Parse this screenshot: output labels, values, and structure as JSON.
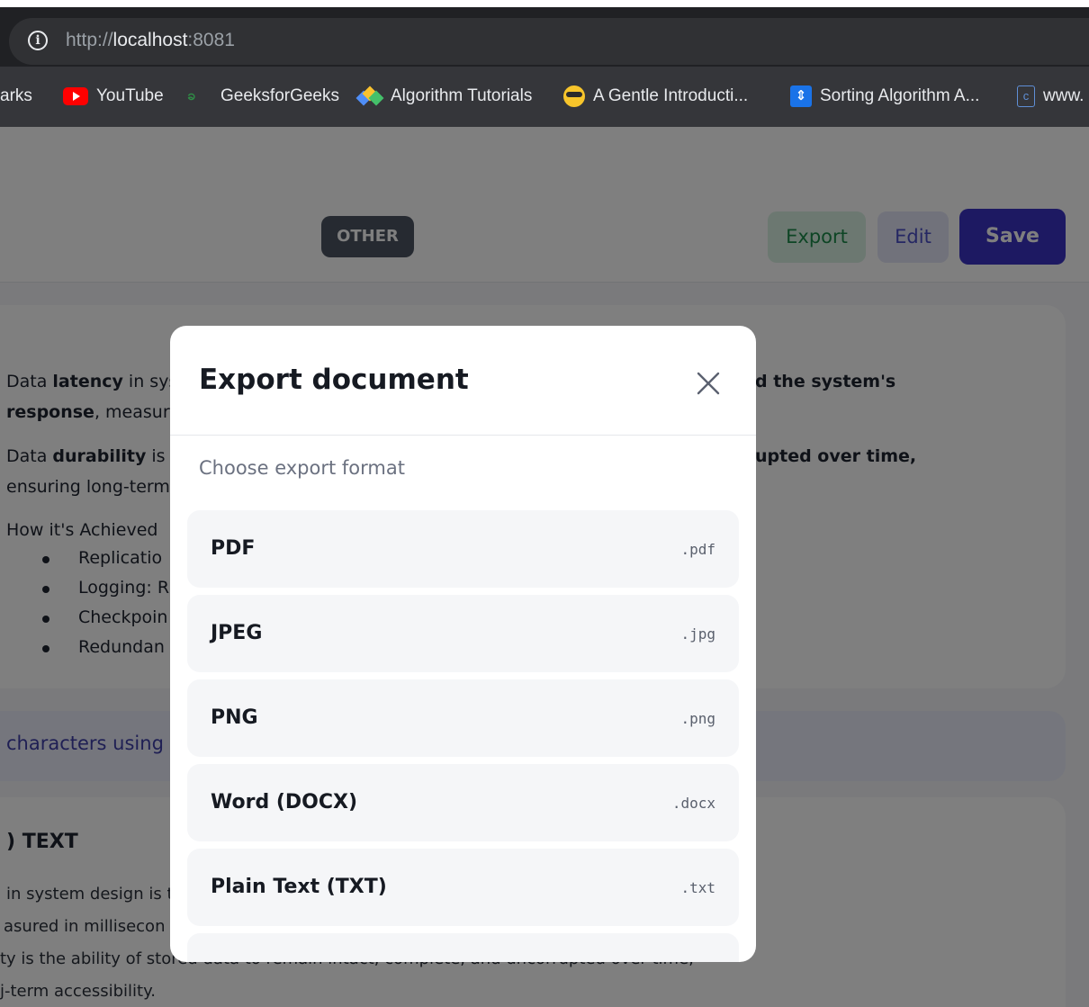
{
  "browser": {
    "url_scheme": "http://",
    "url_host": "localhost",
    "url_port": ":8081",
    "bookmarks": [
      {
        "label": "arks",
        "icon": "bookmarks-folder-icon"
      },
      {
        "label": "YouTube",
        "icon": "youtube-icon"
      },
      {
        "label": "GeeksforGeeks",
        "icon": "geeksforgeeks-icon"
      },
      {
        "label": "Algorithm Tutorials",
        "icon": "algorithm-tutorials-icon"
      },
      {
        "label": "A Gentle Introducti...",
        "icon": "sunglasses-emoji-icon"
      },
      {
        "label": "Sorting Algorithm A...",
        "icon": "sorting-algorithm-icon"
      },
      {
        "label": "www.",
        "icon": "c-file-icon"
      }
    ],
    "icons": {
      "gfg_glyph": "ခ",
      "sort_glyph": "⇕",
      "c_glyph": "c"
    }
  },
  "header": {
    "tag": "OTHER",
    "export_label": "Export",
    "edit_label": "Edit",
    "save_label": "Save"
  },
  "background": {
    "para1_prefix": "Data ",
    "para1_bold": "latency",
    "para1_rest": " in sys",
    "para1_right": "d the system's",
    "para1_line2_bold": "response",
    "para1_line2_rest": ", measur",
    "para2_prefix": "Data ",
    "para2_bold": "durability",
    "para2_rest": " is t",
    "para2_right": "upted over time,",
    "para2_line2": "ensuring long-term",
    "how_title": "How it's Achieved",
    "bullets": [
      "Replicatio",
      "Logging: R",
      "Checkpoin",
      "Redundan"
    ],
    "banner_text": "characters using fr",
    "section_title": ") TEXT",
    "section_lines": [
      "in system design is t",
      "asured in millisecon",
      "ty is the ability of stored data to remain intact, complete, and uncorrupted over time,",
      "j-term accessibility."
    ]
  },
  "modal": {
    "title": "Export document",
    "subtitle": "Choose export format",
    "close_icon": "close-icon",
    "formats": [
      {
        "name": "PDF",
        "ext": ".pdf"
      },
      {
        "name": "JPEG",
        "ext": ".jpg"
      },
      {
        "name": "PNG",
        "ext": ".png"
      },
      {
        "name": "Word (DOCX)",
        "ext": ".docx"
      },
      {
        "name": "Plain Text (TXT)",
        "ext": ".txt"
      }
    ]
  },
  "colors": {
    "save": "#3b32c4",
    "export_text": "#1c8a4a",
    "edit_text": "#4a4fc7",
    "tag_bg": "#4d5563"
  }
}
